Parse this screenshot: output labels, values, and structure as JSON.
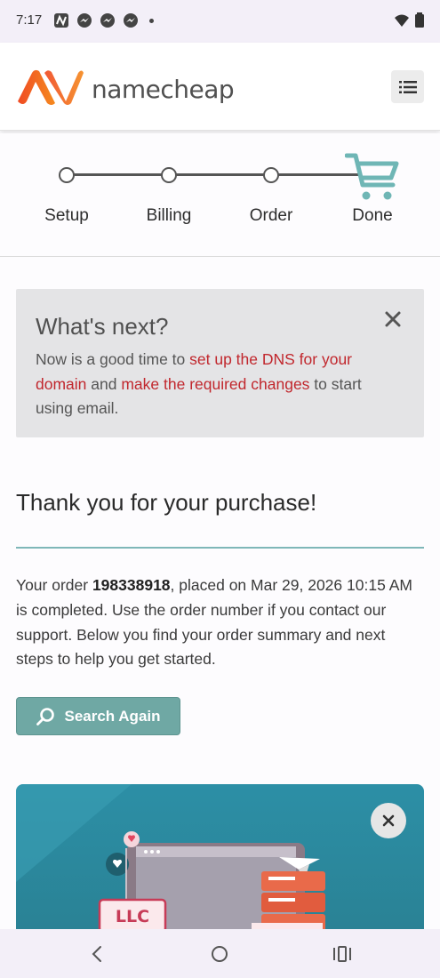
{
  "status_bar": {
    "time": "7:17",
    "notification_icons": [
      "namecheap-notification-icon",
      "messenger-icon",
      "messenger-icon",
      "messenger-icon",
      "more-dot-icon"
    ],
    "right_icons": [
      "wifi-icon",
      "battery-icon"
    ]
  },
  "header": {
    "brand": "namecheap",
    "brand_color": "#f26b1d"
  },
  "stepper": {
    "steps": [
      {
        "label": "Setup"
      },
      {
        "label": "Billing"
      },
      {
        "label": "Order"
      },
      {
        "label": "Done"
      }
    ],
    "active_icon": "cart-icon",
    "accent_color": "#6fb6b5"
  },
  "whats_next": {
    "title": "What's next?",
    "text_before": "Now is a good time to ",
    "link1": "set up the DNS for your domain",
    "text_middle": " and ",
    "link2": "make the required changes",
    "text_after": " to start using email."
  },
  "thank_you": {
    "title": "Thank you for your purchase!",
    "order_prefix": "Your order ",
    "order_number": "198338918",
    "order_suffix": ", placed on Mar 29, 2026 10:15 AM is completed. Use the order number if you contact our support. Below you find your order summary and next steps to help you get started."
  },
  "search_again_button": "Search Again",
  "promo": {
    "badge": "LLC"
  },
  "colors": {
    "link": "#c1272d",
    "button": "#6fa8a4",
    "divider": "#7fb7b8",
    "promo_bg": "#2c8fa6"
  }
}
